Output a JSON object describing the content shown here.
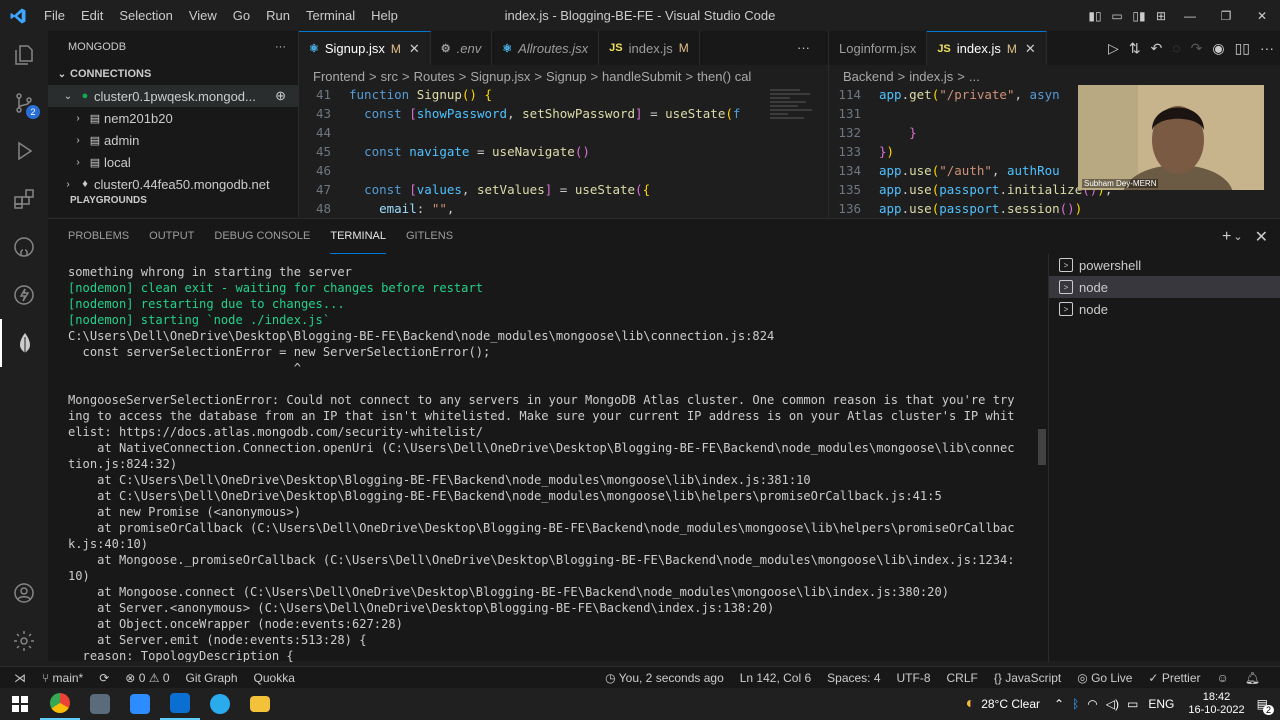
{
  "window": {
    "title": "index.js - Blogging-BE-FE - Visual Studio Code",
    "menu": [
      "File",
      "Edit",
      "Selection",
      "View",
      "Go",
      "Run",
      "Terminal",
      "Help"
    ]
  },
  "activity": {
    "scm_badge": "2"
  },
  "sidebar": {
    "title": "MONGODB",
    "section": "CONNECTIONS",
    "items": [
      {
        "label": "cluster0.1pwqesk.mongod...",
        "level": 1,
        "type": "connection"
      },
      {
        "label": "nem201b20",
        "level": 2,
        "type": "db"
      },
      {
        "label": "admin",
        "level": 2,
        "type": "db"
      },
      {
        "label": "local",
        "level": 2,
        "type": "db"
      },
      {
        "label": "cluster0.44fea50.mongodb.net",
        "level": 1,
        "type": "connection-off"
      }
    ],
    "section2": "PLAYGROUNDS"
  },
  "editor1": {
    "tabs": [
      {
        "label": "Signup.jsx",
        "icon": "react",
        "mod": "M",
        "active": true
      },
      {
        "label": ".env",
        "icon": "gear"
      },
      {
        "label": "Allroutes.jsx",
        "icon": "react"
      },
      {
        "label": "index.js",
        "icon": "js",
        "mod": "M"
      }
    ],
    "breadcrumbs": [
      "Frontend",
      ">",
      "src",
      ">",
      "Routes",
      ">",
      "Signup.jsx",
      ">",
      "Signup",
      ">",
      "handleSubmit",
      ">",
      "then() cal"
    ],
    "lines": [
      {
        "n": "41",
        "code": "function Signup() {"
      },
      {
        "n": "43",
        "code": "  const [showPassword, setShowPassword] = useState(f"
      },
      {
        "n": "44",
        "code": ""
      },
      {
        "n": "45",
        "code": "  const navigate = useNavigate()"
      },
      {
        "n": "46",
        "code": ""
      },
      {
        "n": "47",
        "code": "  const [values, setValues] = useState({"
      },
      {
        "n": "48",
        "code": "    email: \"\","
      }
    ]
  },
  "editor2": {
    "tabs": [
      {
        "label": "Loginform.jsx",
        "icon": "react"
      },
      {
        "label": "index.js",
        "icon": "js",
        "mod": "M",
        "active": true
      }
    ],
    "breadcrumbs": [
      "Backend",
      ">",
      "index.js",
      ">",
      "..."
    ],
    "lines": [
      {
        "n": "114",
        "code": "app.get(\"/private\", asyn"
      },
      {
        "n": "131",
        "code": ""
      },
      {
        "n": "132",
        "code": "    }"
      },
      {
        "n": "133",
        "code": "})"
      },
      {
        "n": "134",
        "code": "app.use(\"/auth\", authRou"
      },
      {
        "n": "135",
        "code": "app.use(passport.initialize());"
      },
      {
        "n": "136",
        "code": "app.use(passport.session())"
      }
    ]
  },
  "webcam": {
    "name": "Subham Dey-MERN"
  },
  "panel": {
    "tabs": [
      "PROBLEMS",
      "OUTPUT",
      "DEBUG CONSOLE",
      "TERMINAL",
      "GITLENS"
    ],
    "active_tab": "TERMINAL",
    "terminals": [
      "powershell",
      "node",
      "node"
    ]
  },
  "terminal": {
    "lines": [
      "something whrong in starting the server",
      "[nodemon] clean exit - waiting for changes before restart",
      "[nodemon] restarting due to changes...",
      "[nodemon] starting `node ./index.js`",
      "C:\\Users\\Dell\\OneDrive\\Desktop\\Blogging-BE-FE\\Backend\\node_modules\\mongoose\\lib\\connection.js:824",
      "  const serverSelectionError = new ServerSelectionError();",
      "                               ^",
      "",
      "MongooseServerSelectionError: Could not connect to any servers in your MongoDB Atlas cluster. One common reason is that you're try",
      "ing to access the database from an IP that isn't whitelisted. Make sure your current IP address is on your Atlas cluster's IP whit",
      "elist: https://docs.atlas.mongodb.com/security-whitelist/",
      "    at NativeConnection.Connection.openUri (C:\\Users\\Dell\\OneDrive\\Desktop\\Blogging-BE-FE\\Backend\\node_modules\\mongoose\\lib\\connec",
      "tion.js:824:32)",
      "    at C:\\Users\\Dell\\OneDrive\\Desktop\\Blogging-BE-FE\\Backend\\node_modules\\mongoose\\lib\\index.js:381:10",
      "    at C:\\Users\\Dell\\OneDrive\\Desktop\\Blogging-BE-FE\\Backend\\node_modules\\mongoose\\lib\\helpers\\promiseOrCallback.js:41:5",
      "    at new Promise (<anonymous>)",
      "    at promiseOrCallback (C:\\Users\\Dell\\OneDrive\\Desktop\\Blogging-BE-FE\\Backend\\node_modules\\mongoose\\lib\\helpers\\promiseOrCallbac",
      "k.js:40:10)",
      "    at Mongoose._promiseOrCallback (C:\\Users\\Dell\\OneDrive\\Desktop\\Blogging-BE-FE\\Backend\\node_modules\\mongoose\\lib\\index.js:1234:",
      "10)",
      "    at Mongoose.connect (C:\\Users\\Dell\\OneDrive\\Desktop\\Blogging-BE-FE\\Backend\\node_modules\\mongoose\\lib\\index.js:380:20)",
      "    at Server.<anonymous> (C:\\Users\\Dell\\OneDrive\\Desktop\\Blogging-BE-FE\\Backend\\index.js:138:20)",
      "    at Object.onceWrapper (node:events:627:28)",
      "    at Server.emit (node:events:513:28) {",
      "  reason: TopologyDescription {"
    ],
    "green_lines": [
      1,
      2,
      3
    ]
  },
  "statusbar": {
    "branch": "main*",
    "errors": "0",
    "warnings": "0",
    "gitgraph": "Git Graph",
    "quokka": "Quokka",
    "blame": "You, 2 seconds ago",
    "cursor": "Ln 142, Col 6",
    "spaces": "Spaces: 4",
    "encoding": "UTF-8",
    "eol": "CRLF",
    "language": "JavaScript",
    "golive": "Go Live",
    "prettier": "Prettier"
  },
  "taskbar": {
    "weather": "28°C  Clear",
    "lang": "ENG",
    "time": "18:42",
    "date": "16-10-2022",
    "notif": "2"
  },
  "colors": {
    "accent": "#0078d4",
    "mongo_green": "#13aa52",
    "terminal_green": "#23d18b"
  }
}
